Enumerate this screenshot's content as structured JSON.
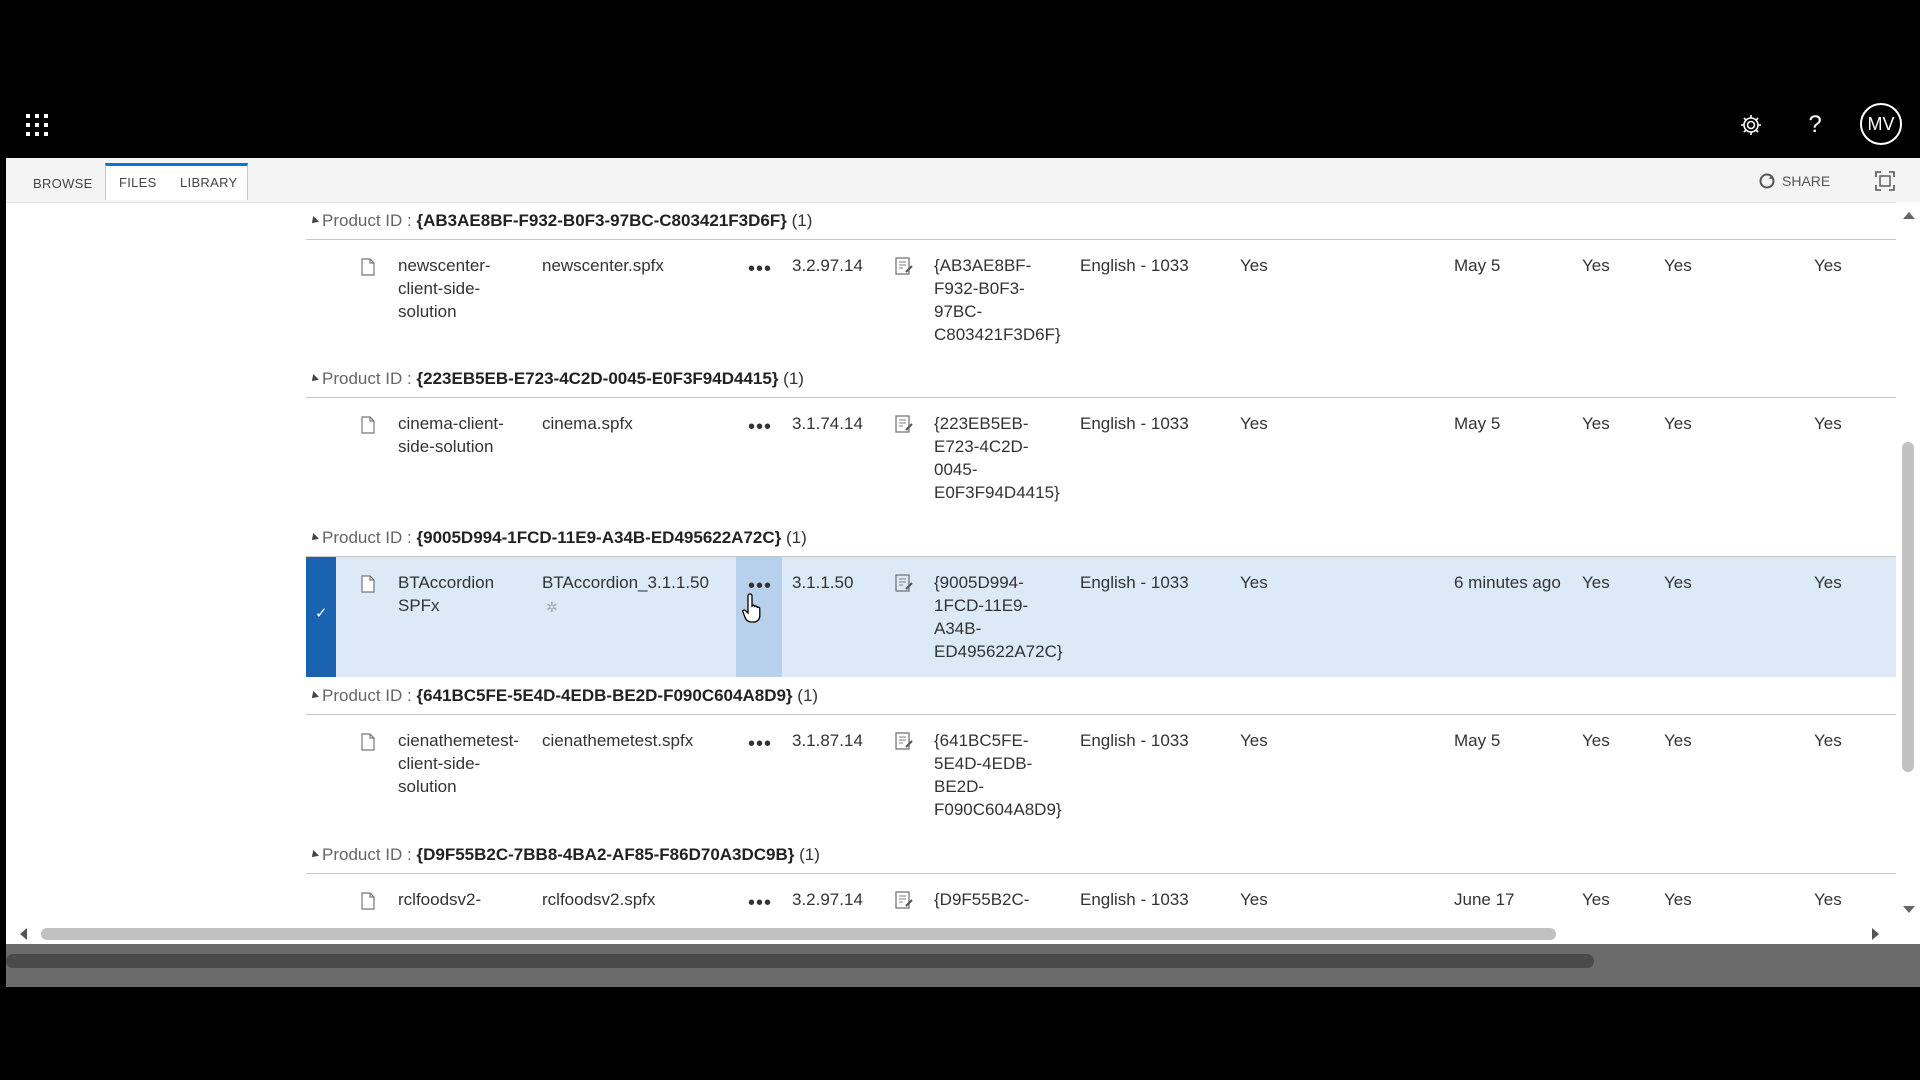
{
  "toolbar": {
    "tabs": [
      "BROWSE",
      "FILES",
      "LIBRARY"
    ],
    "active_tab": "FILES",
    "share_label": "SHARE",
    "avatar_initials": "MV"
  },
  "group_label": "Product ID :",
  "groups": [
    {
      "product_id": "{AB3AE8BF-F932-B0F3-97BC-C803421F3D6F}",
      "count": "(1)",
      "row": {
        "title": [
          "newscenter-",
          "client-side-",
          "solution"
        ],
        "file": "newscenter.spfx",
        "version": "3.2.97.14",
        "product_id_lines": [
          "{AB3AE8BF-",
          "F932-B0F3-",
          "97BC-",
          "C803421F3D6F}"
        ],
        "locale": "English - 1033",
        "col_a": "Yes",
        "modified": "May 5",
        "col_b": "Yes",
        "col_c": "Yes",
        "col_d": "Yes",
        "selected": false
      }
    },
    {
      "product_id": "{223EB5EB-E723-4C2D-0045-E0F3F94D4415}",
      "count": "(1)",
      "row": {
        "title": [
          "cinema-client-",
          "side-solution"
        ],
        "file": "cinema.spfx",
        "version": "3.1.74.14",
        "product_id_lines": [
          "{223EB5EB-",
          "E723-4C2D-",
          "0045-",
          "E0F3F94D4415}"
        ],
        "locale": "English - 1033",
        "col_a": "Yes",
        "modified": "May 5",
        "col_b": "Yes",
        "col_c": "Yes",
        "col_d": "Yes",
        "selected": false
      }
    },
    {
      "product_id": "{9005D994-1FCD-11E9-A34B-ED495622A72C}",
      "count": "(1)",
      "row": {
        "title": [
          "BTAccordion",
          "SPFx"
        ],
        "file": "BTAccordion_3.1.1.50",
        "version": "3.1.1.50",
        "product_id_lines": [
          "{9005D994-",
          "1FCD-11E9-",
          "A34B-",
          "ED495622A72C}"
        ],
        "locale": "English - 1033",
        "col_a": "Yes",
        "modified": "6 minutes ago",
        "col_b": "Yes",
        "col_c": "Yes",
        "col_d": "Yes",
        "selected": true
      }
    },
    {
      "product_id": "{641BC5FE-5E4D-4EDB-BE2D-F090C604A8D9}",
      "count": "(1)",
      "row": {
        "title": [
          "cienathemetest-",
          "client-side-",
          "solution"
        ],
        "file": "cienathemetest.spfx",
        "version": "3.1.87.14",
        "product_id_lines": [
          "{641BC5FE-",
          "5E4D-4EDB-",
          "BE2D-",
          "F090C604A8D9}"
        ],
        "locale": "English - 1033",
        "col_a": "Yes",
        "modified": "May 5",
        "col_b": "Yes",
        "col_c": "Yes",
        "col_d": "Yes",
        "selected": false
      }
    },
    {
      "product_id": "{D9F55B2C-7BB8-4BA2-AF85-F86D70A3DC9B}",
      "count": "(1)",
      "row": {
        "title": [
          "rclfoodsv2-"
        ],
        "file": "rclfoodsv2.spfx",
        "version": "3.2.97.14",
        "product_id_lines": [
          "{D9F55B2C-"
        ],
        "locale": "English - 1033",
        "col_a": "Yes",
        "modified": "June 17",
        "col_b": "Yes",
        "col_c": "Yes",
        "col_d": "Yes",
        "selected": false
      }
    }
  ]
}
